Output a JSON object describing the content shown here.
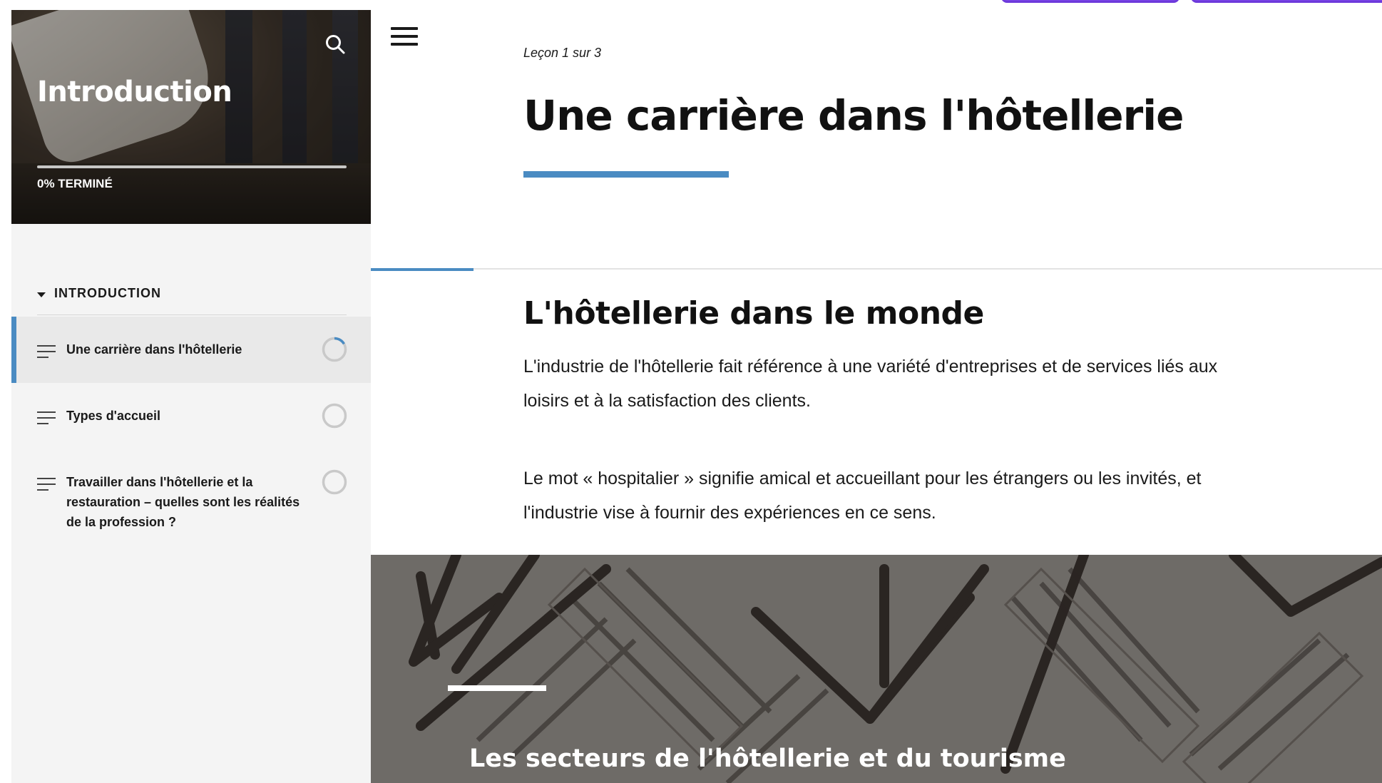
{
  "sidebar": {
    "course_title": "Introduction",
    "progress_percent": 0,
    "progress_label": "0% TERMINÉ",
    "section_title": "INTRODUCTION",
    "lessons": [
      {
        "title": "Une carrière dans l'hôtellerie",
        "status": "in-progress",
        "active": true
      },
      {
        "title": "Types d'accueil",
        "status": "not-started",
        "active": false
      },
      {
        "title": "Travailler dans l'hôtellerie et la restauration – quelles sont les réalités de la profession ?",
        "status": "not-started",
        "active": false
      }
    ]
  },
  "main": {
    "lesson_counter": "Leçon 1 sur 3",
    "lesson_title": "Une carrière dans l'hôtellerie",
    "section_heading": "L'hôtellerie dans le monde",
    "paragraphs": [
      "L'industrie de l'hôtellerie fait référence à une variété d'entreprises et de services liés aux loisirs et à la satisfaction des clients.",
      "Le mot « hospitalier » signifie amical et accueillant pour les étrangers ou les invités, et l'industrie vise à fournir des expériences en ce sens."
    ],
    "banner_title": "Les secteurs de l'hôtellerie et du tourisme"
  },
  "colors": {
    "accent": "#4a8bc2",
    "top_tab": "#7b46e8",
    "banner_bg": "#6e6b67",
    "banner_pattern": "#2a2522"
  },
  "icons": {
    "search": "search-icon",
    "menu": "hamburger-menu-icon",
    "lesson_type": "text-lines-icon",
    "status_in_progress": "progress-ring-icon",
    "status_not_started": "empty-circle-icon",
    "section_toggle": "caret-down-icon"
  }
}
